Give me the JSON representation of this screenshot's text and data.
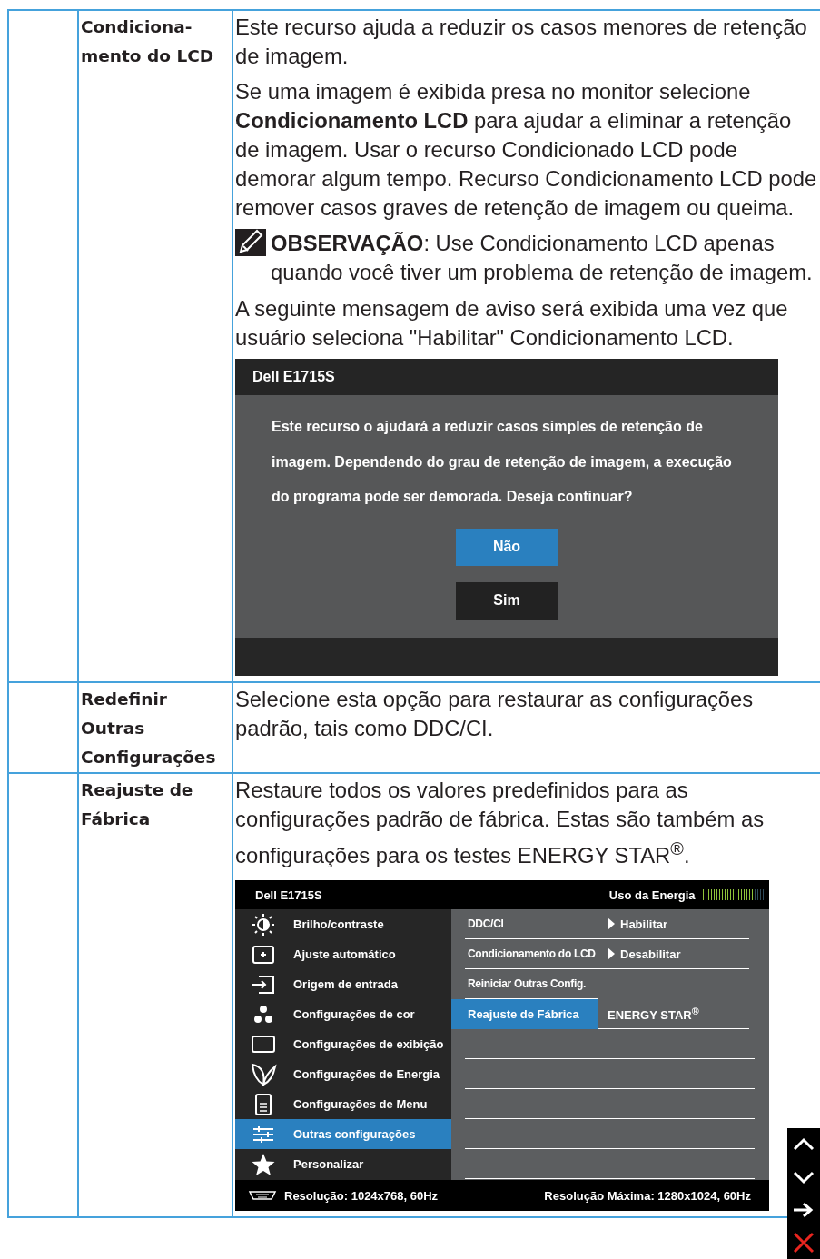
{
  "rows": [
    {
      "term": "Condiciona-mento do LCD",
      "blocks": [
        {
          "kind": "paragraph",
          "text": "Este recurso ajuda a reduzir os casos menores de retenção de imagem."
        },
        {
          "kind": "paragraph",
          "text": "Se uma imagem é exibida presa no monitor selecione **Condicionamento LCD** para ajudar a eliminar a retenção de imagem. Usar o recurso Condicionado LCD pode demorar algum tempo. Recurso Condicionamento LCD pode remover casos graves de retenção de imagem ou queima."
        },
        {
          "kind": "note",
          "text": "**OBSERVAÇÃO**: Use Condicionamento LCD apenas quando você tiver um problema de retenção de imagem."
        },
        {
          "kind": "paragraph",
          "text": "A seguinte mensagem de aviso será exibida uma vez que usuário seleciona \"Habilitar\" Condicionamento LCD."
        },
        {
          "kind": "dialog",
          "title": "Dell E1715S",
          "message": "Este recurso o ajudará a reduzir casos simples de retenção de imagem. Dependendo do grau de retenção de imagem, a execução do programa pode ser demorada. Deseja continuar?",
          "buttons": [
            {
              "label": "Não",
              "selected": true
            },
            {
              "label": "Sim",
              "selected": false
            }
          ]
        }
      ]
    },
    {
      "term": "Redefinir Outras Configurações",
      "blocks": [
        {
          "kind": "paragraph",
          "text": "Selecione esta opção para restaurar as configurações padrão, tais como DDC/CI."
        }
      ]
    },
    {
      "term": "Reajuste de Fábrica",
      "blocks": [
        {
          "kind": "paragraph",
          "text": "Restaure todos os valores predefinidos para as configurações padrão de fábrica. Estas são também as configurações para os testes ENERGY STAR$^{®}$."
        },
        {
          "kind": "osd",
          "title": "Dell E1715S",
          "meter_label": "Uso da Energia",
          "level": 0.82,
          "menu": [
            {
              "label": "Brilho/contraste",
              "selected": false
            },
            {
              "label": "Ajuste automático",
              "selected": false
            },
            {
              "label": "Origem de entrada",
              "selected": false
            },
            {
              "label": "Configurações de cor",
              "selected": false
            },
            {
              "label": "Configurações de exibição",
              "selected": false
            },
            {
              "label": "Configurações de Energia",
              "selected": false
            },
            {
              "label": "Configurações de Menu",
              "selected": false
            },
            {
              "label": "Outras configurações",
              "selected": true
            },
            {
              "label": "Personalizar",
              "selected": false
            }
          ],
          "submenu": [
            {
              "label": "DDC/CI",
              "option": "Habilitar",
              "arrow": true,
              "selected": false
            },
            {
              "label": "Condicionamento do LCD",
              "option": "Desabilitar",
              "arrow": true,
              "selected": false
            },
            {
              "label": "Reiniciar Outras Config.",
              "selected": false
            },
            {
              "label": "Reajuste de Fábrica",
              "option": "ENERGY STAR$^{®}$",
              "arrow": false,
              "selected": true
            }
          ],
          "footer_left": "Resolução: 1024x768, 60Hz",
          "footer_right": "Resolução Máxima: 1280x1024, 60Hz"
        }
      ]
    }
  ]
}
